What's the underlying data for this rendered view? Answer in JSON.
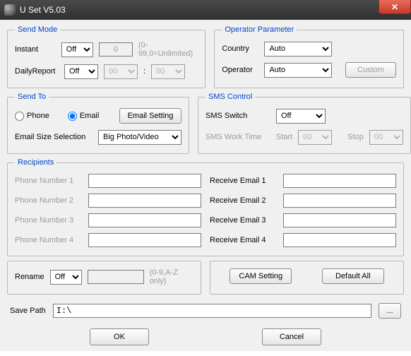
{
  "window": {
    "title": "U Set V5.03"
  },
  "sendMode": {
    "legend": "Send Mode",
    "instant_label": "Instant",
    "instant_value": "Off",
    "instant_count": "0",
    "instant_hint": "(0-99,0=Unlimited)",
    "daily_label": "DailyReport",
    "daily_value": "Off",
    "daily_hour": "00",
    "daily_min": "00",
    "time_sep": ":"
  },
  "operator": {
    "legend": "Operator Parameter",
    "country_label": "Country",
    "country_value": "Auto",
    "operator_label": "Operator",
    "operator_value": "Auto",
    "custom_btn": "Custom"
  },
  "sendTo": {
    "legend": "Send To",
    "phone_label": "Phone",
    "email_label": "Email",
    "email_setting_btn": "Email Setting",
    "size_label": "Email Size Selection",
    "size_value": "Big Photo/Video"
  },
  "sms": {
    "legend": "SMS Control",
    "switch_label": "SMS Switch",
    "switch_value": "Off",
    "worktime_label": "SMS Work Time",
    "start_label": "Start",
    "start_value": "00",
    "stop_label": "Stop",
    "stop_value": "00"
  },
  "recipients": {
    "legend": "Recipients",
    "phone_labels": [
      "Phone Number 1",
      "Phone Number 2",
      "Phone Number 3",
      "Phone Number 4"
    ],
    "email_labels": [
      "Receive Email 1",
      "Receive Email 2",
      "Receive Email 3",
      "Receive Email 4"
    ]
  },
  "rename": {
    "label": "Rename",
    "value": "Off",
    "text": "",
    "hint": "(0-9,A-Z only)"
  },
  "camdefault": {
    "cam_btn": "CAM Setting",
    "default_btn": "Default All"
  },
  "save": {
    "label": "Save Path",
    "value": "I:\\",
    "browse": "..."
  },
  "buttons": {
    "ok": "OK",
    "cancel": "Cancel"
  }
}
